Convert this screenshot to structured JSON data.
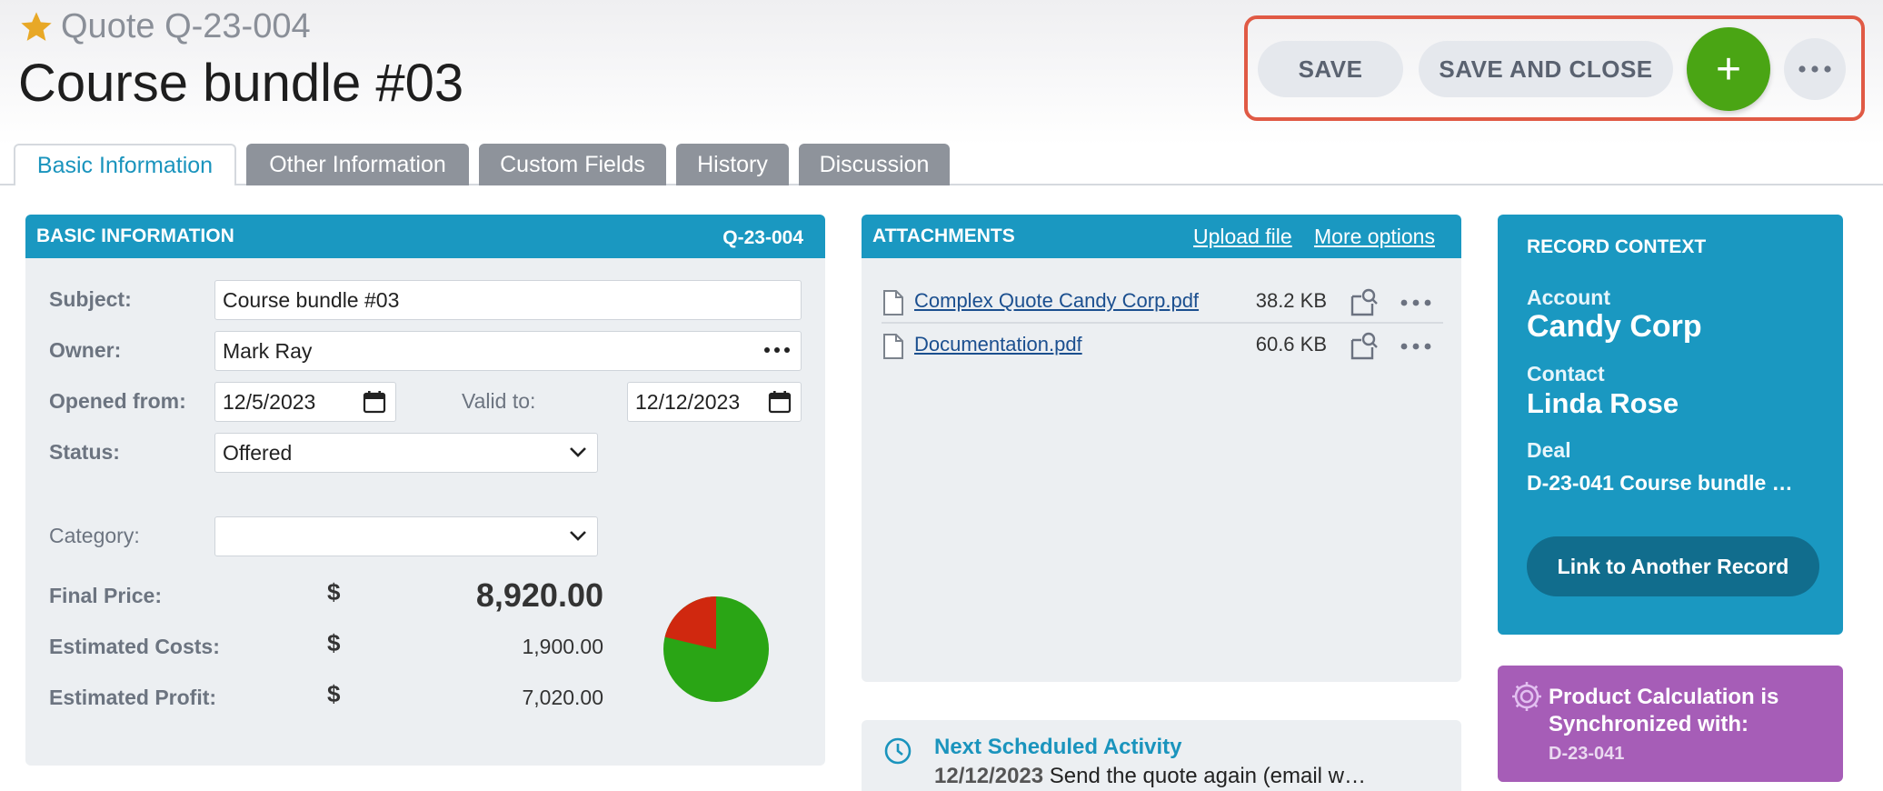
{
  "header": {
    "record_type": "Quote Q-23-004",
    "title": "Course bundle #03",
    "save_label": "SAVE",
    "save_close_label": "SAVE AND CLOSE",
    "add_label": "+"
  },
  "tabs": [
    {
      "label": "Basic Information"
    },
    {
      "label": "Other Information"
    },
    {
      "label": "Custom Fields"
    },
    {
      "label": "History"
    },
    {
      "label": "Discussion"
    }
  ],
  "basic": {
    "heading": "BASIC INFORMATION",
    "code": "Q-23-004",
    "subject_label": "Subject:",
    "subject_value": "Course bundle #03",
    "owner_label": "Owner:",
    "owner_value": "Mark Ray",
    "opened_label": "Opened from:",
    "opened_value": "12/5/2023",
    "valid_label": "Valid to:",
    "valid_value": "12/12/2023",
    "status_label": "Status:",
    "status_value": "Offered",
    "category_label": "Category:",
    "category_value": "",
    "final_price_label": "Final Price:",
    "final_price_value": "8,920.00",
    "costs_label": "Estimated Costs:",
    "costs_value": "1,900.00",
    "profit_label": "Estimated Profit:",
    "profit_value": "7,020.00",
    "currency": "$",
    "pie": {
      "costs_fraction": 0.213,
      "costs_color": "#d0280f",
      "profit_color": "#2aa515"
    }
  },
  "attachments": {
    "heading": "ATTACHMENTS",
    "upload_label": "Upload file",
    "more_label": "More options",
    "files": [
      {
        "name": "Complex Quote Candy Corp.pdf",
        "size": "38.2 KB"
      },
      {
        "name": "Documentation.pdf",
        "size": "60.6 KB"
      }
    ]
  },
  "activity": {
    "title": "Next Scheduled Activity",
    "date": "12/12/2023",
    "text": "Send the quote again (email w…"
  },
  "context": {
    "heading": "RECORD CONTEXT",
    "account_label": "Account",
    "account_value": "Candy Corp",
    "contact_label": "Contact",
    "contact_value": "Linda Rose",
    "deal_label": "Deal",
    "deal_value": "D-23-041 Course bundle …",
    "link_button": "Link to Another Record"
  },
  "sync": {
    "title": "Product Calculation is Synchronized with:",
    "code": "D-23-041"
  },
  "colors": {
    "accent": "#1a98c1",
    "add_button": "#4aa514",
    "sync_panel": "#a65db7",
    "highlight_outline": "#e05a45"
  }
}
